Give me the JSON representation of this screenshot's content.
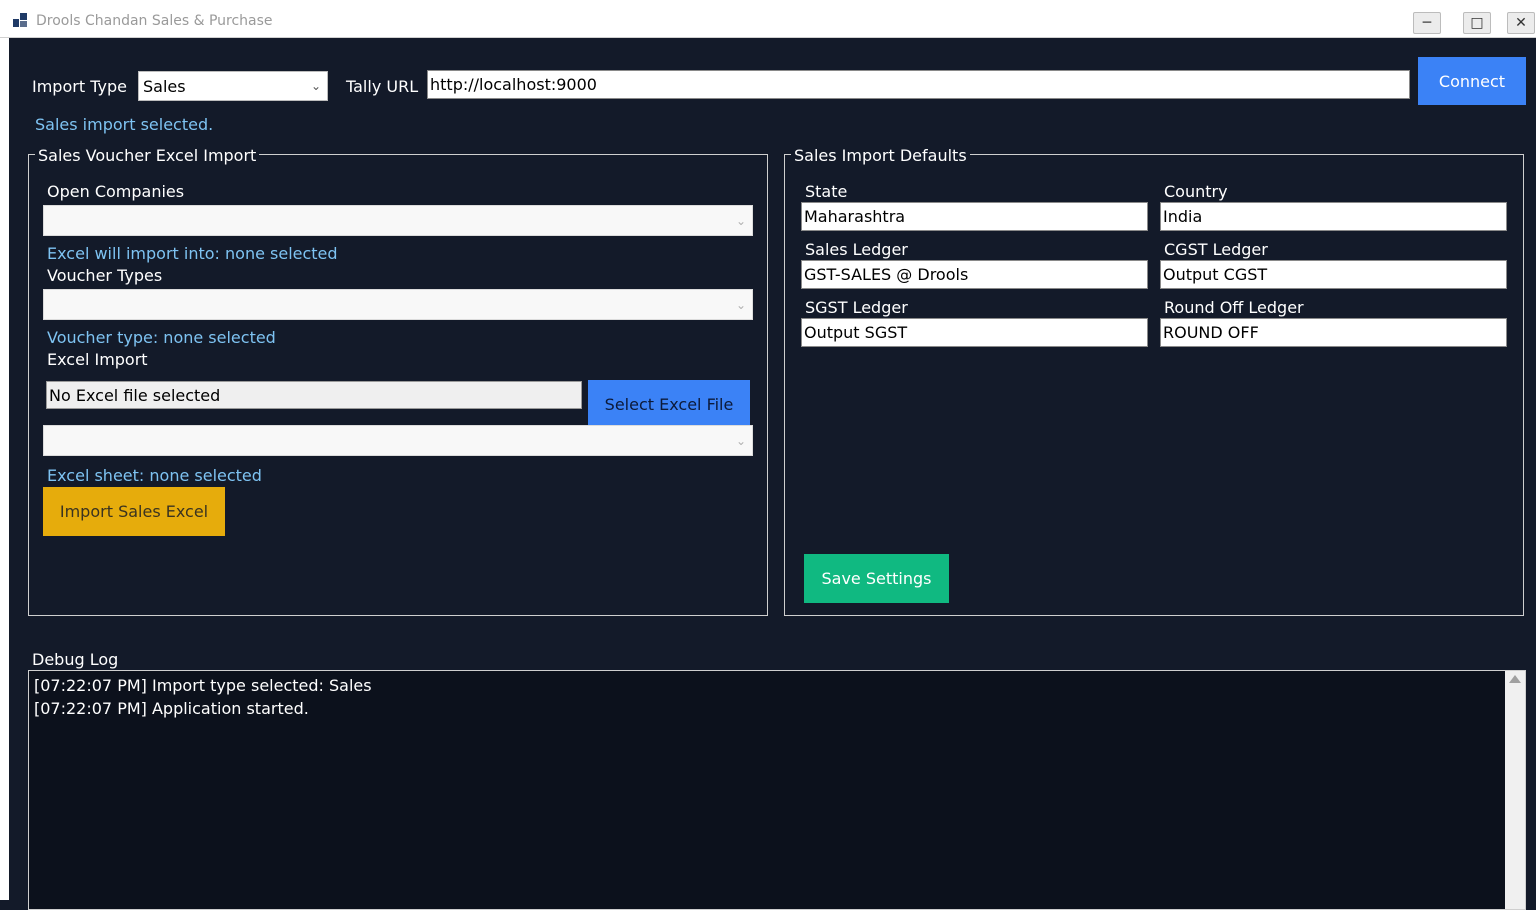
{
  "window": {
    "title": "Drools Chandan Sales & Purchase",
    "controls": {
      "minimize": "─",
      "maximize": "□",
      "close": "✕"
    }
  },
  "top": {
    "import_type_label": "Import Type",
    "import_type_value": "Sales",
    "tally_url_label": "Tally URL",
    "tally_url_value": "http://localhost:9000",
    "connect_label": "Connect",
    "status": "Sales import selected."
  },
  "left_group": {
    "title": "Sales Voucher  Excel Import",
    "open_companies_label": "Open Companies",
    "open_companies_value": "",
    "companies_status": "Excel will import into: none selected",
    "voucher_types_label": "Voucher Types",
    "voucher_types_value": "",
    "voucher_status": "Voucher type: none selected",
    "excel_import_label": "Excel Import",
    "file_path_value": "No Excel file selected",
    "select_file_label": "Select Excel File",
    "sheet_value": "",
    "sheet_status": "Excel sheet: none selected",
    "import_button_label": "Import Sales Excel"
  },
  "right_group": {
    "title": "Sales Import Defaults",
    "fields": [
      {
        "label": "State",
        "value": "Maharashtra"
      },
      {
        "label": "Country",
        "value": "India"
      },
      {
        "label": "Sales Ledger",
        "value": "GST-SALES @ Drools"
      },
      {
        "label": "CGST Ledger",
        "value": "Output CGST"
      },
      {
        "label": "SGST Ledger",
        "value": "Output SGST"
      },
      {
        "label": "Round Off Ledger",
        "value": "ROUND OFF"
      }
    ],
    "save_label": "Save Settings"
  },
  "debug": {
    "label": "Debug Log",
    "lines": [
      "[07:22:07 PM] Import type selected: Sales",
      "[07:22:07 PM] Application started."
    ]
  },
  "colors": {
    "background": "#131a29",
    "status_text": "#7ec3f2",
    "connect_bg": "#3b82f6",
    "select_file_bg": "#3b82f6",
    "import_bg": "#e6ac0c",
    "save_bg": "#10b981"
  },
  "icons": {
    "dropdown": "chevron-down-icon",
    "app": "app-icon"
  }
}
